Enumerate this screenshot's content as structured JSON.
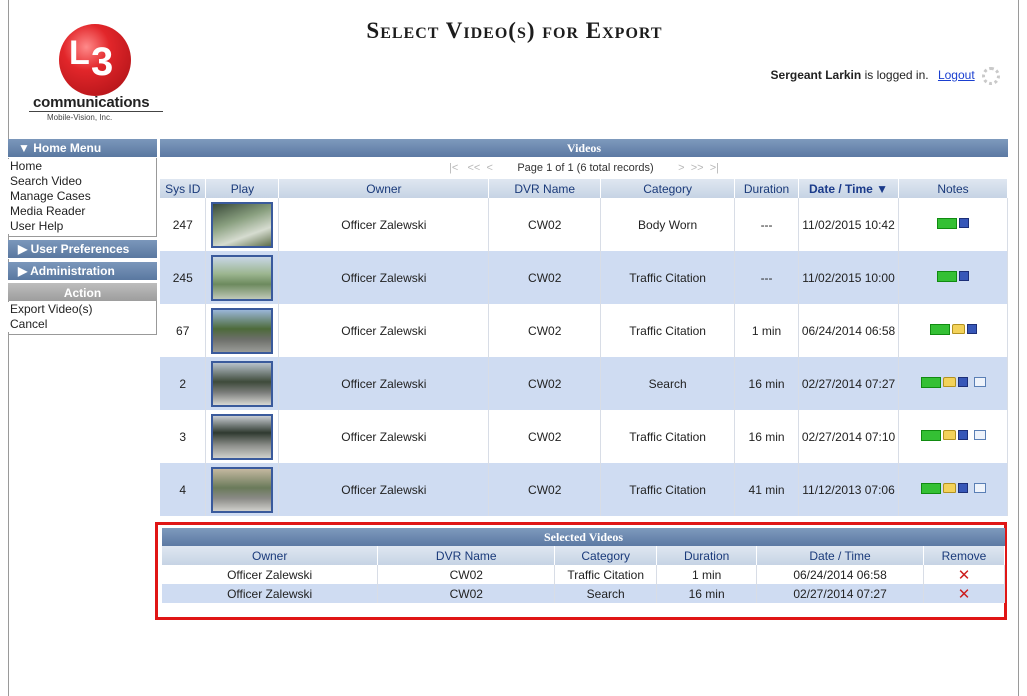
{
  "header": {
    "title": "Select Video(s) for Export",
    "logo_text": "communications",
    "logo_sub": "Mobile-Vision, Inc.",
    "logo_mark_l": "L",
    "logo_mark_3": "3",
    "user_name": "Sergeant Larkin",
    "logged_in_text": "is logged in.",
    "logout_label": "Logout"
  },
  "menu": {
    "home_menu_label": "▼  Home Menu",
    "items": [
      "Home",
      "Search Video",
      "Manage Cases",
      "Media Reader",
      "User Help"
    ],
    "user_prefs_label": "▶  User Preferences",
    "admin_label": "▶  Administration",
    "action_label": "Action",
    "action_items": [
      "Export Video(s)",
      "Cancel"
    ]
  },
  "videos": {
    "title": "Videos",
    "pager_text": "Page 1 of 1 (6 total records)",
    "pager_first": "|<",
    "pager_prev_fast": "<<",
    "pager_prev": "<",
    "pager_next": ">",
    "pager_next_fast": ">>",
    "pager_last": ">|",
    "columns": [
      "Sys ID",
      "Play",
      "Owner",
      "DVR Name",
      "Category",
      "Duration",
      "Date / Time ▼",
      "Notes"
    ],
    "rows": [
      {
        "sys_id": "247",
        "owner": "Officer Zalewski",
        "dvr": "CW02",
        "category": "Body Worn",
        "duration": "---",
        "datetime": "11/02/2015 10:42"
      },
      {
        "sys_id": "245",
        "owner": "Officer Zalewski",
        "dvr": "CW02",
        "category": "Traffic Citation",
        "duration": "---",
        "datetime": "11/02/2015 10:00"
      },
      {
        "sys_id": "67",
        "owner": "Officer Zalewski",
        "dvr": "CW02",
        "category": "Traffic Citation",
        "duration": "1 min",
        "datetime": "06/24/2014 06:58"
      },
      {
        "sys_id": "2",
        "owner": "Officer Zalewski",
        "dvr": "CW02",
        "category": "Search",
        "duration": "16 min",
        "datetime": "02/27/2014 07:27"
      },
      {
        "sys_id": "3",
        "owner": "Officer Zalewski",
        "dvr": "CW02",
        "category": "Traffic Citation",
        "duration": "16 min",
        "datetime": "02/27/2014 07:10"
      },
      {
        "sys_id": "4",
        "owner": "Officer Zalewski",
        "dvr": "CW02",
        "category": "Traffic Citation",
        "duration": "41 min",
        "datetime": "11/12/2013 07:06"
      }
    ]
  },
  "selected": {
    "title": "Selected Videos",
    "columns": [
      "Owner",
      "DVR Name",
      "Category",
      "Duration",
      "Date / Time",
      "Remove"
    ],
    "rows": [
      {
        "owner": "Officer Zalewski",
        "dvr": "CW02",
        "category": "Traffic Citation",
        "duration": "1 min",
        "datetime": "06/24/2014 06:58",
        "remove": "✕"
      },
      {
        "owner": "Officer Zalewski",
        "dvr": "CW02",
        "category": "Search",
        "duration": "16 min",
        "datetime": "02/27/2014 07:27",
        "remove": "✕"
      }
    ]
  },
  "colors": {
    "accent_blue": "#5c79a3",
    "row_alt": "#cfdcf2",
    "highlight_red": "#e01616",
    "remove_red": "#cc1f1f"
  }
}
